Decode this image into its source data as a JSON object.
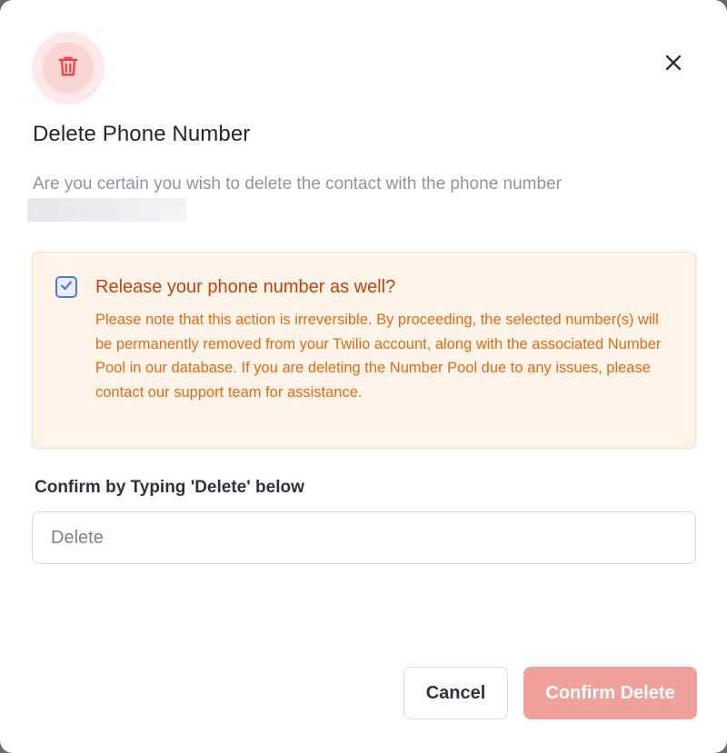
{
  "dialog": {
    "icon": "trash-icon",
    "close_icon": "close-icon",
    "title": "Delete Phone Number",
    "description": "Are you certain you wish to delete the contact with the phone number"
  },
  "warning": {
    "checked": true,
    "title": "Release your phone number as well?",
    "text": "Please note that this action is irreversible. By proceeding, the selected number(s) will be permanently removed from your Twilio account, along with the associated Number Pool in our database. If you are deleting the Number Pool due to any issues, please contact our support team for assistance."
  },
  "confirm": {
    "label": "Confirm by Typing 'Delete' below",
    "placeholder": "Delete",
    "value": ""
  },
  "buttons": {
    "cancel": "Cancel",
    "confirm": "Confirm Delete"
  },
  "colors": {
    "danger": "#ef4444",
    "warning_text": "#e16a13",
    "checkbox_accent": "#4f78e0",
    "confirm_button": "#f0a19b"
  }
}
